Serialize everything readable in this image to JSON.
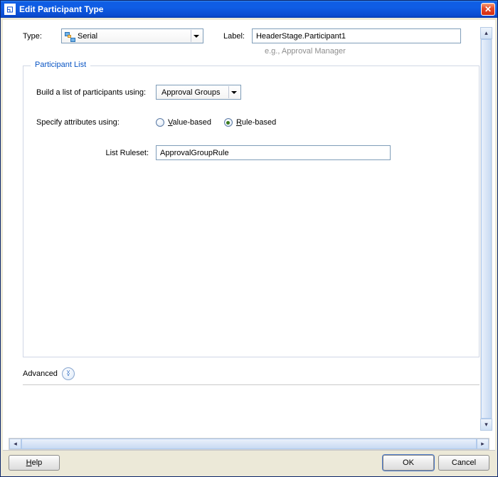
{
  "window": {
    "title": "Edit Participant Type"
  },
  "form": {
    "type_label": "Type:",
    "type_value": "Serial",
    "label_label": "Label:",
    "label_value": "HeaderStage.Participant1",
    "label_hint": "e.g., Approval Manager"
  },
  "participant_list": {
    "legend": "Participant List",
    "build_label": "Build a list of participants using:",
    "build_value": "Approval Groups",
    "specify_label": "Specify attributes using:",
    "radio_value_prefix": "V",
    "radio_value_rest": "alue-based",
    "radio_rule_prefix": "R",
    "radio_rule_rest": "ule-based",
    "selected": "rule",
    "ruleset_label": "List Ruleset:",
    "ruleset_value": "ApprovalGroupRule"
  },
  "advanced": {
    "label": "Advanced"
  },
  "buttons": {
    "help_prefix": "H",
    "help_rest": "elp",
    "ok": "OK",
    "cancel": "Cancel"
  }
}
